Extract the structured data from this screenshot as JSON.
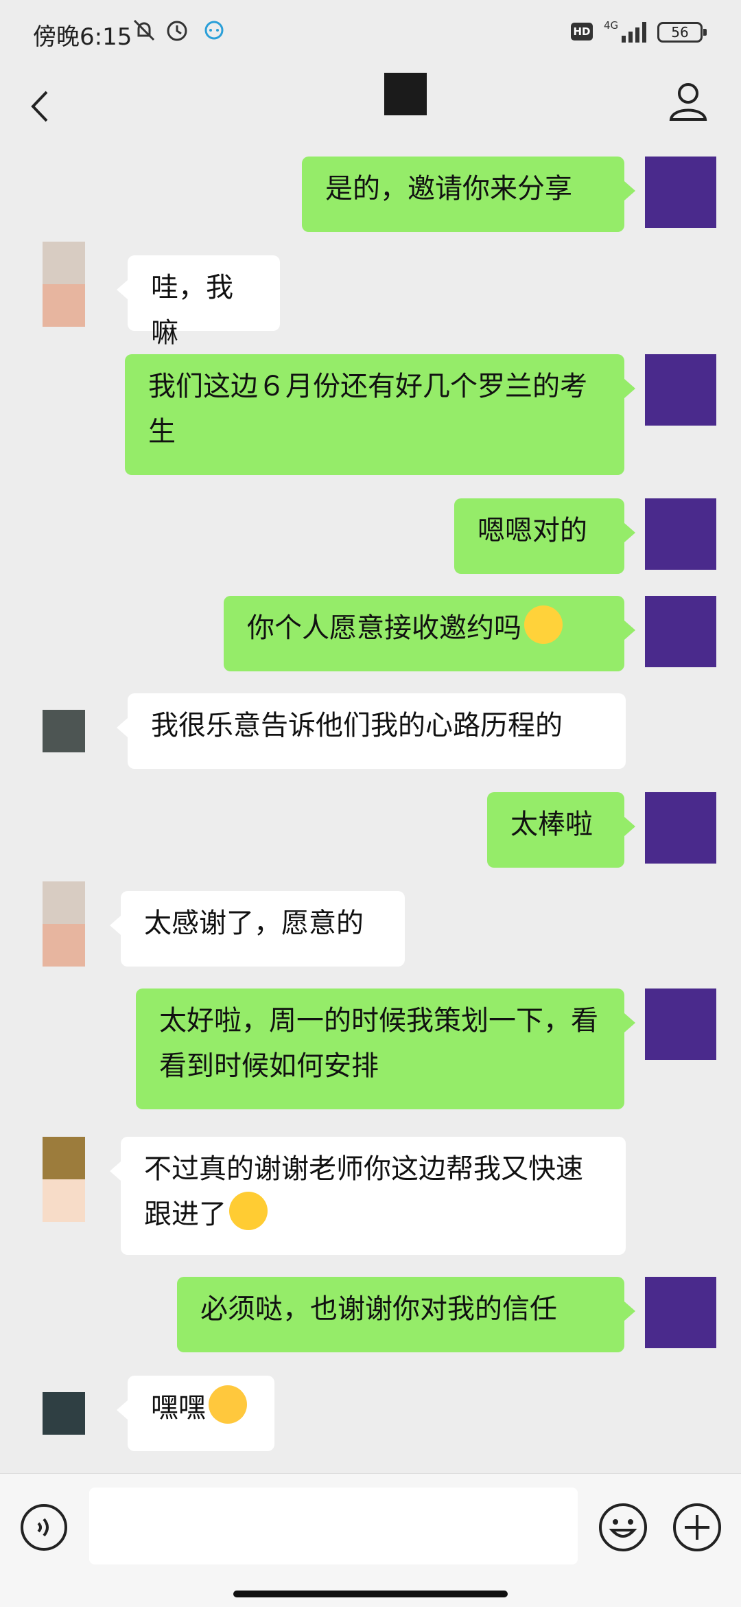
{
  "status": {
    "time": "傍晚6:15",
    "hd": "HD",
    "network": "4G",
    "battery": "56"
  },
  "nav": {
    "back_icon": "chevron-left-icon",
    "profile_icon": "person-icon"
  },
  "messages": [
    {
      "side": "me",
      "text": "是的，邀请你来分享"
    },
    {
      "side": "other",
      "text": "哇，我嘛"
    },
    {
      "side": "me",
      "text": "我们这边６月份还有好几个罗兰的考生"
    },
    {
      "side": "me",
      "text": "嗯嗯对的"
    },
    {
      "side": "me",
      "text": "你个人愿意接收邀约吗",
      "emoji": "smile-emoji"
    },
    {
      "side": "other",
      "text": "我很乐意告诉他们我的心路历程的"
    },
    {
      "side": "me",
      "text": "太棒啦"
    },
    {
      "side": "other",
      "text": "太感谢了，愿意的"
    },
    {
      "side": "me",
      "text": "太好啦，周一的时候我策划一下，看看到时候如何安排"
    },
    {
      "side": "other",
      "text": "不过真的谢谢老师你这边帮我又快速跟进了",
      "emoji": "crying-emoji"
    },
    {
      "side": "me",
      "text": "必须哒，也谢谢你对我的信任"
    },
    {
      "side": "other",
      "text": "嘿嘿",
      "emoji": "grin-emoji"
    }
  ],
  "colors": {
    "me_bubble": "#95ec69",
    "other_bubble": "#ffffff",
    "background": "#ededed",
    "avatar_me": "#4a2a8c"
  }
}
